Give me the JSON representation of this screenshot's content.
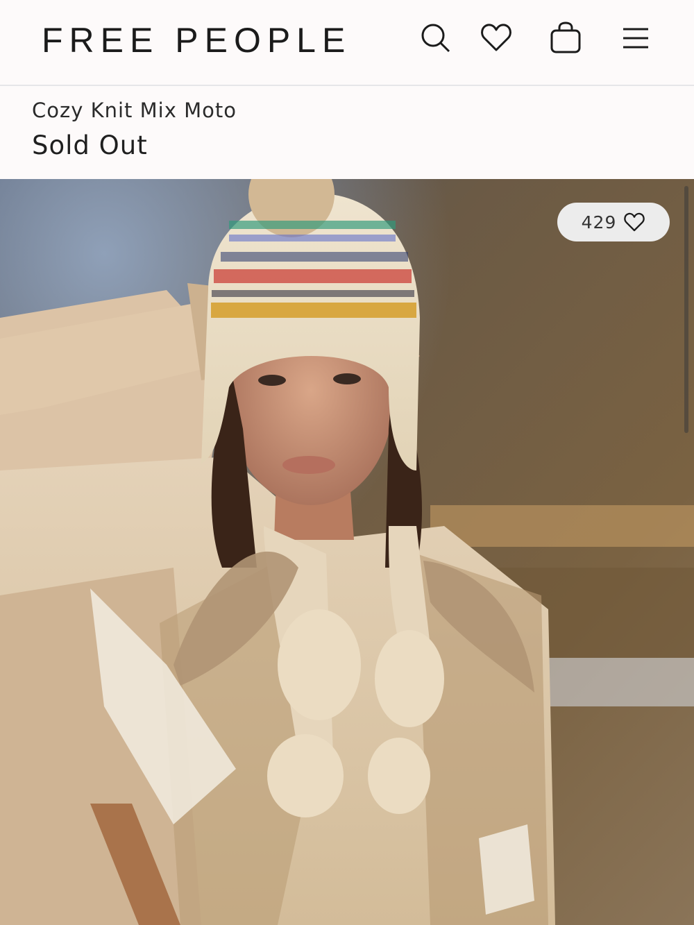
{
  "header": {
    "logo": "FREE PEOPLE",
    "icons": {
      "search": "search-icon",
      "wishlist": "heart-icon",
      "bag": "shopping-bag-icon",
      "menu": "hamburger-menu-icon"
    }
  },
  "product": {
    "name": "Cozy Knit Mix Moto",
    "status": "Sold Out",
    "favorites_count": "429"
  },
  "colors": {
    "background": "#fdfafa",
    "text": "#1f1f1f",
    "pill": "#ececec"
  }
}
